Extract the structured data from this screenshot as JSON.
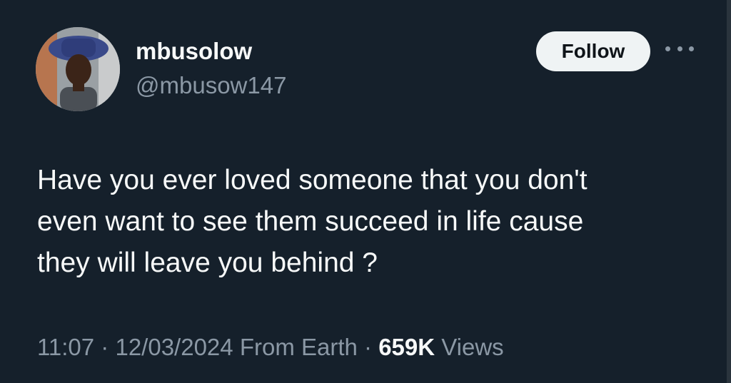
{
  "author": {
    "display_name": "mbusolow",
    "handle": "@mbusow147",
    "avatar_icon": "profile-photo"
  },
  "actions": {
    "follow_label": "Follow",
    "more_icon": "more-horizontal-icon"
  },
  "tweet": {
    "lines": [
      "Have you ever loved someone that you don't",
      "even want to see them succeed in life cause",
      "they will leave you behind ?"
    ]
  },
  "meta": {
    "time": "11:07",
    "separator": " · ",
    "date": "12/03/2024",
    "source": "From Earth",
    "views_count": "659K",
    "views_label": "Views"
  },
  "colors": {
    "background": "#15202b",
    "primary_text": "#f7f9f9",
    "secondary_text": "#8b98a5",
    "follow_bg": "#eff3f4"
  }
}
